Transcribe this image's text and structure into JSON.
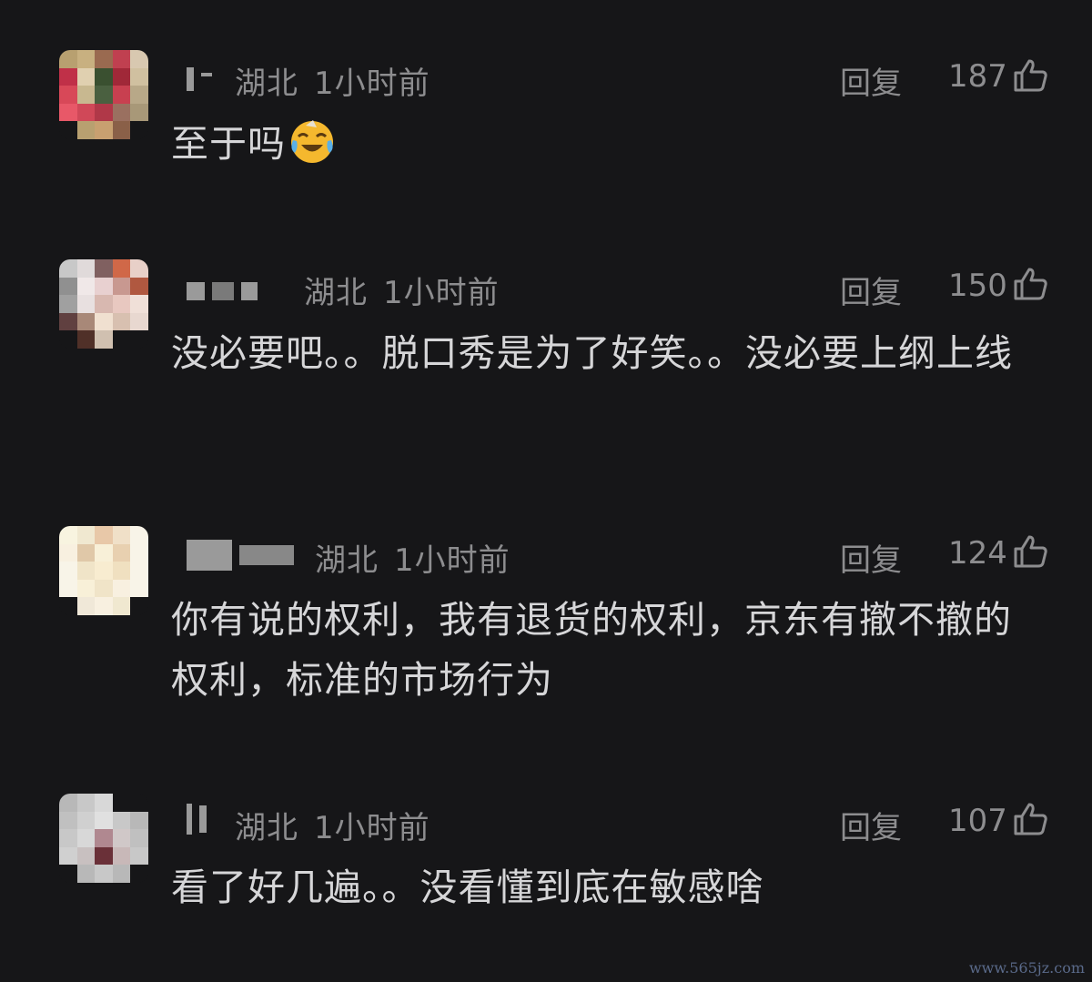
{
  "comments": [
    {
      "location": "湖北",
      "time": "1小时前",
      "reply_label": "回复",
      "likes": "187",
      "text": "至于吗",
      "emoji": "crying-laughing-face"
    },
    {
      "location": "湖北",
      "time": "1小时前",
      "reply_label": "回复",
      "likes": "150",
      "text": "没必要吧。。脱口秀是为了好笑。。没必要上纲上线"
    },
    {
      "location": "湖北",
      "time": "1小时前",
      "reply_label": "回复",
      "likes": "124",
      "text": "你有说的权利，我有退货的权利，京东有撤不撤的权利，标准的市场行为"
    },
    {
      "location": "湖北",
      "time": "1小时前",
      "reply_label": "回复",
      "likes": "107",
      "text": "看了好几遍。。没看懂到底在敏感啥"
    }
  ],
  "icons": {
    "like": "thumbs-up-icon"
  },
  "watermark": "www.565jz.com",
  "colors": {
    "background": "#161618",
    "meta_text": "#8d8d8f",
    "body_text": "#d6d6d8"
  }
}
